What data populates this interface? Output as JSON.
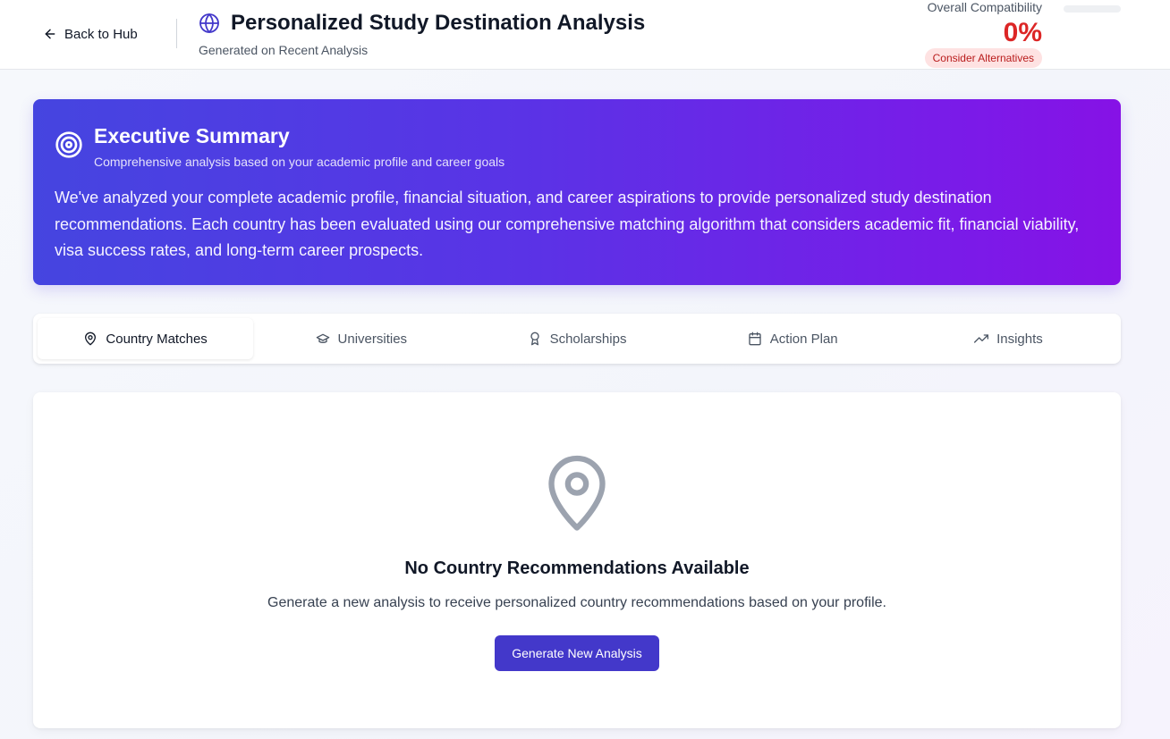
{
  "header": {
    "back_label": "Back to Hub",
    "title": "Personalized Study Destination Analysis",
    "subtitle": "Generated on Recent Analysis",
    "compatibility_label": "Overall Compatibility",
    "compatibility_value": "0%",
    "compatibility_badge": "Consider Alternatives",
    "compatibility_progress": 0
  },
  "summary": {
    "title": "Executive Summary",
    "subtitle": "Comprehensive analysis based on your academic profile and career goals",
    "body": "We've analyzed your complete academic profile, financial situation, and career aspirations to provide personalized study destination recommendations. Each country has been evaluated using our comprehensive matching algorithm that considers academic fit, financial viability, visa success rates, and long-term career prospects."
  },
  "tabs": [
    {
      "label": "Country Matches",
      "icon": "map-pin-icon",
      "active": true
    },
    {
      "label": "Universities",
      "icon": "graduation-cap-icon",
      "active": false
    },
    {
      "label": "Scholarships",
      "icon": "award-icon",
      "active": false
    },
    {
      "label": "Action Plan",
      "icon": "calendar-icon",
      "active": false
    },
    {
      "label": "Insights",
      "icon": "trending-up-icon",
      "active": false
    }
  ],
  "empty_state": {
    "title": "No Country Recommendations Available",
    "text": "Generate a new analysis to receive personalized country recommendations based on your profile.",
    "button_label": "Generate New Analysis",
    "icon": "map-pin-icon"
  },
  "colors": {
    "accent": "#4338ca",
    "danger": "#dc2626",
    "gradient_start": "#4545e0",
    "gradient_end": "#8612e6"
  }
}
